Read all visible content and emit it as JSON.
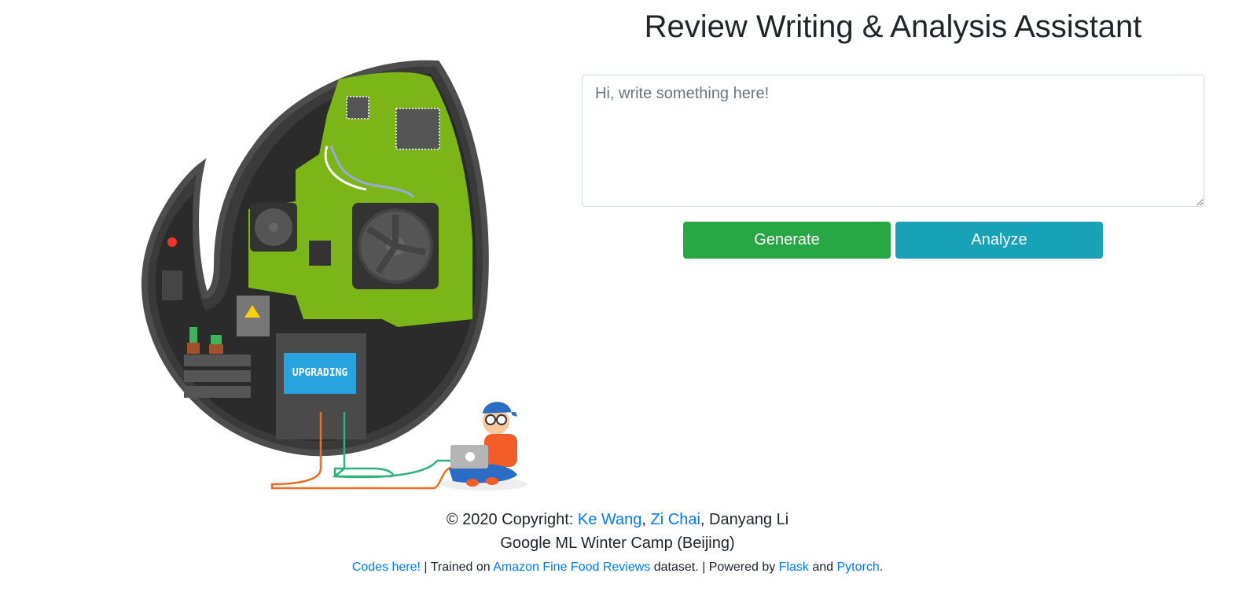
{
  "header": {
    "title": "Review Writing & Analysis Assistant"
  },
  "illustration": {
    "screen_text": "UPGRADING"
  },
  "form": {
    "placeholder": "Hi, write something here!",
    "generate_label": "Generate",
    "analyze_label": "Analyze"
  },
  "footer": {
    "copyright_prefix": "© 2020 Copyright: ",
    "author1": "Ke Wang",
    "sep1": ", ",
    "author2": "Zi Chai",
    "sep2": ", Danyang Li",
    "camp": "Google ML Winter Camp (Beijing)",
    "codes_link": "Codes here!",
    "trained_text": " | Trained on ",
    "dataset_link": "Amazon Fine Food Reviews",
    "dataset_suffix": " dataset. | Powered by ",
    "flask_link": "Flask",
    "and_text": " and ",
    "pytorch_link": "Pytorch",
    "period": "."
  },
  "colors": {
    "generate": "#28a745",
    "analyze": "#17a2b8",
    "link": "#007bff",
    "circuit_green": "#7cb518"
  }
}
